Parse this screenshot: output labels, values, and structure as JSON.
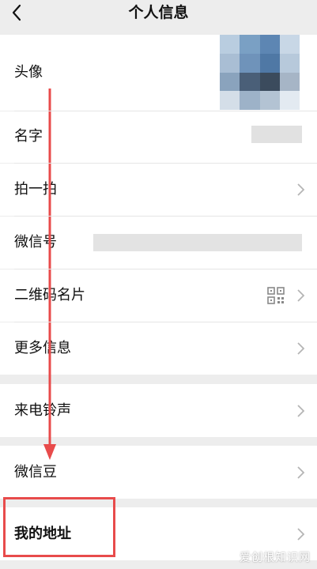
{
  "header": {
    "title": "个人信息",
    "back_icon": "chevron-left-icon"
  },
  "rows": {
    "avatar": {
      "label": "头像"
    },
    "name": {
      "label": "名字"
    },
    "pat": {
      "label": "拍一拍"
    },
    "wechat_id": {
      "label": "微信号"
    },
    "qr_card": {
      "label": "二维码名片",
      "icon": "qr-code-icon"
    },
    "more_info": {
      "label": "更多信息"
    },
    "ringtone": {
      "label": "来电铃声"
    },
    "wechat_beans": {
      "label": "微信豆"
    },
    "my_address": {
      "label": "我的地址"
    }
  },
  "annotation": {
    "arrow_color": "#e84b4b",
    "highlight_color": "#e84b4b"
  },
  "watermark": {
    "text": "爱创根知识网"
  }
}
